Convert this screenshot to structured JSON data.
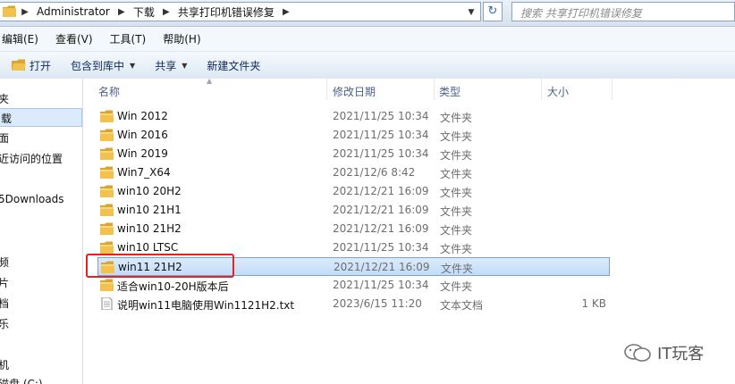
{
  "address": {
    "crumbs": [
      "Administrator",
      "下载",
      "共享打印机错误修复"
    ],
    "search_placeholder": "搜索 共享打印机错误修复"
  },
  "menu": [
    "编辑(E)",
    "查看(V)",
    "工具(T)",
    "帮助(H)"
  ],
  "toolbar": {
    "open": "打开",
    "include_library": "包含到库中",
    "share": "共享",
    "new_folder": "新建文件夹"
  },
  "sidebar": [
    {
      "label": "夹"
    },
    {
      "label": "载"
    },
    {
      "label": "面"
    },
    {
      "label": "近访问的位置"
    },
    {
      "label": "5Downloads"
    },
    {
      "label": "频"
    },
    {
      "label": "片"
    },
    {
      "label": "档"
    },
    {
      "label": "乐"
    },
    {
      "label": "机"
    },
    {
      "label": "磁盘 (C:)"
    }
  ],
  "columns": {
    "name": "名称",
    "date": "修改日期",
    "type": "类型",
    "size": "大小"
  },
  "files": [
    {
      "name": "Win 2012",
      "date": "2021/11/25 10:34",
      "type": "文件夹",
      "size": "",
      "icon": "folder-icon"
    },
    {
      "name": "Win 2016",
      "date": "2021/11/25 10:34",
      "type": "文件夹",
      "size": "",
      "icon": "folder-icon"
    },
    {
      "name": "Win 2019",
      "date": "2021/11/25 10:34",
      "type": "文件夹",
      "size": "",
      "icon": "folder-icon"
    },
    {
      "name": "Win7_X64",
      "date": "2021/12/6 8:42",
      "type": "文件夹",
      "size": "",
      "icon": "folder-icon"
    },
    {
      "name": "win10 20H2",
      "date": "2021/12/21 16:09",
      "type": "文件夹",
      "size": "",
      "icon": "folder-icon"
    },
    {
      "name": "win10 21H1",
      "date": "2021/12/21 16:09",
      "type": "文件夹",
      "size": "",
      "icon": "folder-icon"
    },
    {
      "name": "win10 21H2",
      "date": "2021/12/21 16:09",
      "type": "文件夹",
      "size": "",
      "icon": "folder-icon"
    },
    {
      "name": "win10 LTSC",
      "date": "2021/11/25 10:34",
      "type": "文件夹",
      "size": "",
      "icon": "folder-icon"
    },
    {
      "name": "win11 21H2",
      "date": "2021/12/21 16:09",
      "type": "文件夹",
      "size": "",
      "icon": "folder-icon",
      "selected": true
    },
    {
      "name": "适合win10-20H版本后",
      "date": "2021/11/25 10:34",
      "type": "文件夹",
      "size": "",
      "icon": "folder-icon"
    },
    {
      "name": "说明win11电脑使用Win1121H2.txt",
      "date": "2023/6/15 11:20",
      "type": "文本文档",
      "size": "1 KB",
      "icon": "text-file-icon"
    }
  ],
  "watermark": "IT玩客",
  "colors": {
    "folder": "#f2c14e",
    "highlight_box": "#e22323",
    "selection": "#cce4fb"
  }
}
